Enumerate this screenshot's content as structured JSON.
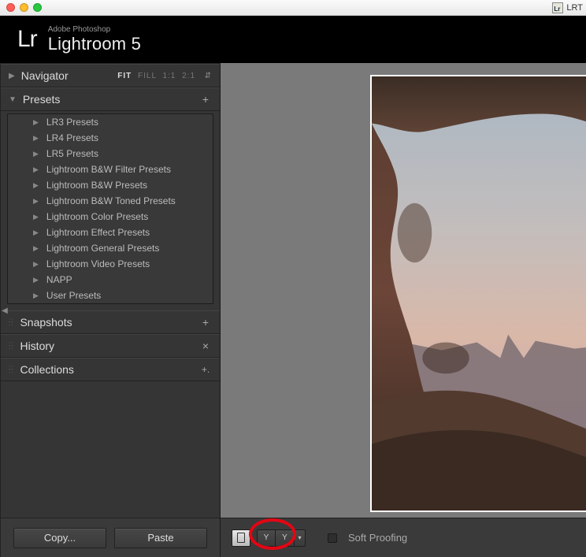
{
  "titlebar": {
    "lrt_text": "LRT"
  },
  "branding": {
    "sup": "Adobe Photoshop",
    "main": "Lightroom 5",
    "logo": "Lr"
  },
  "navigator": {
    "label": "Navigator",
    "zoom_fit": "FIT",
    "zoom_fill": "FILL",
    "zoom_11": "1:1",
    "zoom_21": "2:1"
  },
  "presets": {
    "label": "Presets",
    "folders": [
      "LR3 Presets",
      "LR4 Presets",
      "LR5 Presets",
      "Lightroom B&W Filter Presets",
      "Lightroom B&W Presets",
      "Lightroom B&W Toned Presets",
      "Lightroom Color Presets",
      "Lightroom Effect Presets",
      "Lightroom General Presets",
      "Lightroom Video Presets",
      "NAPP",
      "User Presets"
    ]
  },
  "snapshots": {
    "label": "Snapshots"
  },
  "history": {
    "label": "History"
  },
  "collections": {
    "label": "Collections"
  },
  "buttons": {
    "copy": "Copy...",
    "paste": "Paste"
  },
  "toolbar": {
    "soft_proofing": "Soft Proofing",
    "compare_glyph": "Y"
  }
}
